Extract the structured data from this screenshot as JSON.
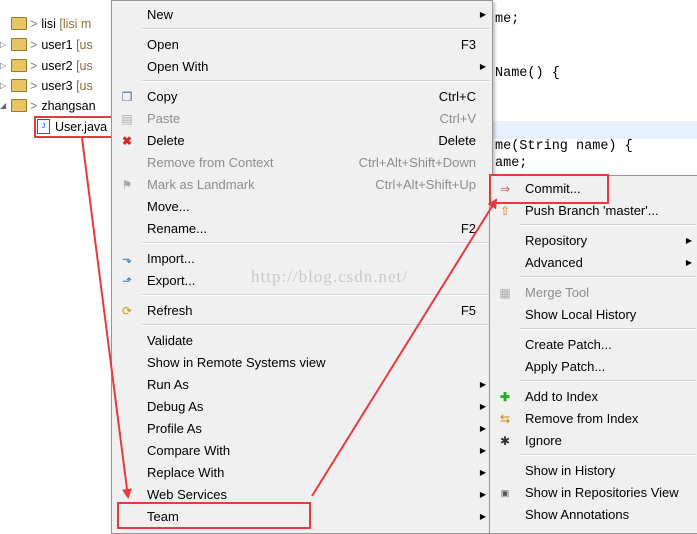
{
  "tree": {
    "items": [
      {
        "label": "lisi",
        "decoration": "[lisi m"
      },
      {
        "label": "user1",
        "decoration": "[us"
      },
      {
        "label": "user2",
        "decoration": "[us"
      },
      {
        "label": "user3",
        "decoration": "[us"
      },
      {
        "label": "zhangsan",
        "decoration": ""
      }
    ],
    "prefix": ">",
    "file": "User.java"
  },
  "editor": {
    "lines": [
      "me;",
      "Name() {",
      "me(String name) {",
      "ame;"
    ]
  },
  "context_menu": {
    "items": [
      {
        "label": "New",
        "shortcut": "",
        "submenu": true,
        "icon": ""
      },
      {
        "label": "Open",
        "shortcut": "F3",
        "icon": ""
      },
      {
        "label": "Open With",
        "shortcut": "",
        "submenu": true,
        "icon": ""
      },
      {
        "label": "Copy",
        "shortcut": "Ctrl+C",
        "icon": "copy-icon"
      },
      {
        "label": "Paste",
        "shortcut": "Ctrl+V",
        "disabled": true,
        "icon": "paste-icon"
      },
      {
        "label": "Delete",
        "shortcut": "Delete",
        "icon": "delete-icon"
      },
      {
        "label": "Remove from Context",
        "shortcut": "Ctrl+Alt+Shift+Down",
        "disabled": true,
        "icon": ""
      },
      {
        "label": "Mark as Landmark",
        "shortcut": "Ctrl+Alt+Shift+Up",
        "disabled": true,
        "icon": "landmark-icon"
      },
      {
        "label": "Move...",
        "shortcut": "",
        "icon": ""
      },
      {
        "label": "Rename...",
        "shortcut": "F2",
        "icon": ""
      },
      {
        "label": "Import...",
        "shortcut": "",
        "icon": "import-icon"
      },
      {
        "label": "Export...",
        "shortcut": "",
        "icon": "export-icon"
      },
      {
        "label": "Refresh",
        "shortcut": "F5",
        "icon": "refresh-icon"
      },
      {
        "label": "Validate",
        "shortcut": "",
        "icon": ""
      },
      {
        "label": "Show in Remote Systems view",
        "shortcut": "",
        "icon": ""
      },
      {
        "label": "Run As",
        "shortcut": "",
        "submenu": true,
        "icon": ""
      },
      {
        "label": "Debug As",
        "shortcut": "",
        "submenu": true,
        "icon": ""
      },
      {
        "label": "Profile As",
        "shortcut": "",
        "submenu": true,
        "icon": ""
      },
      {
        "label": "Compare With",
        "shortcut": "",
        "submenu": true,
        "icon": ""
      },
      {
        "label": "Replace With",
        "shortcut": "",
        "submenu": true,
        "icon": ""
      },
      {
        "label": "Web Services",
        "shortcut": "",
        "submenu": true,
        "icon": ""
      },
      {
        "label": "Team",
        "shortcut": "",
        "submenu": true,
        "icon": ""
      }
    ]
  },
  "team_menu": {
    "items": [
      {
        "label": "Commit...",
        "icon": "commit-icon"
      },
      {
        "label": "Push Branch 'master'...",
        "icon": "push-icon"
      },
      {
        "label": "Repository",
        "submenu": true,
        "icon": ""
      },
      {
        "label": "Advanced",
        "submenu": true,
        "icon": ""
      },
      {
        "label": "Merge Tool",
        "disabled": true,
        "icon": "merge-icon"
      },
      {
        "label": "Show Local History",
        "icon": ""
      },
      {
        "label": "Create Patch...",
        "icon": ""
      },
      {
        "label": "Apply Patch...",
        "icon": ""
      },
      {
        "label": "Add to Index",
        "icon": "add-index-icon"
      },
      {
        "label": "Remove from Index",
        "icon": "remove-index-icon"
      },
      {
        "label": "Ignore",
        "icon": "ignore-icon"
      },
      {
        "label": "Show in History",
        "icon": ""
      },
      {
        "label": "Show in Repositories View",
        "icon": "git-repo-icon"
      },
      {
        "label": "Show Annotations",
        "icon": ""
      }
    ]
  },
  "watermark": "http://blog.csdn.net/",
  "colors": {
    "annotation": "#e8393c",
    "menu_bg": "#f0f0f0"
  }
}
